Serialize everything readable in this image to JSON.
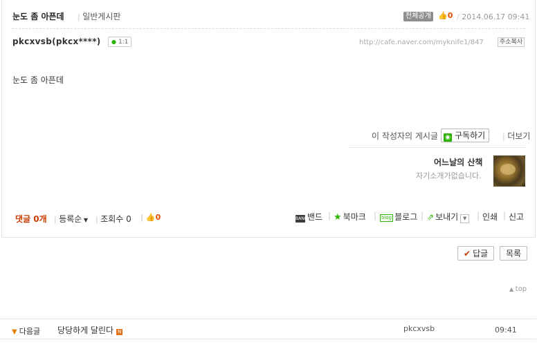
{
  "header": {
    "title": "눈도 좀 아픈데",
    "board": "일반게시판",
    "visibility_badge": "전체공개",
    "like_count": "0",
    "date": "2014.06.17 09:41"
  },
  "author": {
    "id": "pkcxvsb(pkcx****)",
    "chat_label": "1:1",
    "url": "http://cafe.naver.com/myknife1/847",
    "copy_label": "주소복사"
  },
  "content": {
    "body": "눈도 좀 아픈데"
  },
  "writer": {
    "posts_label": "이 작성자의 게시글",
    "subscribe_label": "구독하기",
    "more_label": "더보기",
    "nickname": "어느날의 산책",
    "intro": "자기소개가없습니다."
  },
  "footer": {
    "comment_label": "댓글",
    "comment_count": "0개",
    "sort_label": "등록순",
    "views_label": "조회수",
    "views_count": "0",
    "like_count": "0",
    "share": {
      "band": "밴드",
      "bookmark": "북마크",
      "blog": "블로그",
      "send": "보내기",
      "print": "인쇄",
      "report": "신고"
    }
  },
  "actions": {
    "reply_label": "답글",
    "list_label": "목록",
    "top_label": "top"
  },
  "next_post": {
    "label": "다음글",
    "title": "당당하게 달린다",
    "author": "pkcxvsb",
    "time": "09:41"
  },
  "colors": {
    "accent_orange": "#c83c00",
    "naver_green": "#2db400"
  }
}
